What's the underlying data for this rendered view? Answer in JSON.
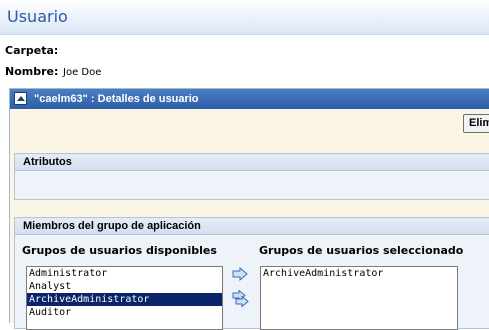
{
  "header": {
    "title": "Usuario"
  },
  "fields": {
    "carpeta_label": "Carpeta:",
    "nombre_label": "Nombre:",
    "nombre_value": "Joe Doe"
  },
  "panel": {
    "title": "\"caelm63\" : Detalles de usuario",
    "elim_button": "Elim",
    "atributos": {
      "title": "Atributos"
    },
    "miembros": {
      "title": "Miembros del grupo de aplicación",
      "available_label": "Grupos de usuarios disponibles",
      "selected_label": "Grupos de usuarios seleccionado",
      "available": [
        {
          "label": "Administrator",
          "selected": false
        },
        {
          "label": "Analyst",
          "selected": false
        },
        {
          "label": "ArchiveAdministrator",
          "selected": true
        },
        {
          "label": "Auditor",
          "selected": false
        }
      ],
      "selected": [
        {
          "label": "ArchiveAdministrator"
        }
      ]
    }
  },
  "colors": {
    "title_blue": "#2a5aa6",
    "titlebar_blue": "#2c5ea7",
    "panel_bg": "#fbf5e6",
    "selection": "#0a246a"
  },
  "icons": [
    "collapse-icon",
    "move-right-arrow-icon",
    "move-all-right-arrow-icon"
  ]
}
